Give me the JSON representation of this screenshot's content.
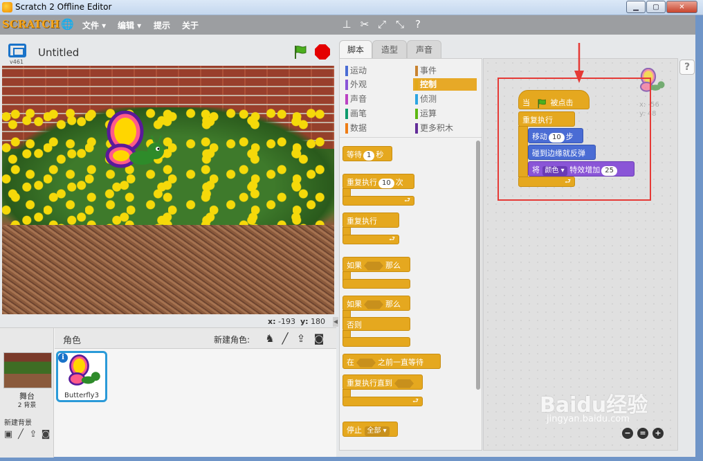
{
  "window": {
    "title": "Scratch 2 Offline Editor"
  },
  "menu": {
    "logo": "SCRATCH",
    "items": [
      "文件 ▾",
      "编辑 ▾",
      "提示",
      "关于"
    ]
  },
  "stage": {
    "version": "v461",
    "project_title": "Untitled",
    "mouse_x_label": "x:",
    "mouse_x": "-193",
    "mouse_y_label": "y:",
    "mouse_y": "180"
  },
  "sprites_pane": {
    "title": "角色",
    "new_sprite_label": "新建角色:",
    "stage_label": "舞台",
    "stage_bg_count": "2 背景",
    "new_backdrop_label": "新建背景",
    "sprite_name": "Butterfly3"
  },
  "tabs": [
    "脚本",
    "造型",
    "声音"
  ],
  "categories": [
    {
      "label": "运动",
      "color": "#4a6cd4"
    },
    {
      "label": "外观",
      "color": "#8a55d7"
    },
    {
      "label": "声音",
      "color": "#bb42c3"
    },
    {
      "label": "画笔",
      "color": "#0e9a6c"
    },
    {
      "label": "数据",
      "color": "#ee7d16"
    },
    {
      "label": "事件",
      "color": "#c88330"
    },
    {
      "label": "控制",
      "color": "#e1a91a"
    },
    {
      "label": "侦测",
      "color": "#2ca5e2"
    },
    {
      "label": "运算",
      "color": "#5cb712"
    },
    {
      "label": "更多积木",
      "color": "#632d99"
    }
  ],
  "palette_blocks": {
    "wait_pre": "等待",
    "wait_num": "1",
    "wait_post": "秒",
    "repeat_pre": "重复执行",
    "repeat_num": "10",
    "repeat_post": "次",
    "forever": "重复执行",
    "if_pre": "如果",
    "if_post": "那么",
    "ifelse_pre": "如果",
    "ifelse_post": "那么",
    "else": "否则",
    "waituntil_pre": "在",
    "waituntil_post": "之前一直等待",
    "repeatuntil": "重复执行直到",
    "stop_pre": "停止",
    "stop_dd": "全部"
  },
  "script": {
    "hat_pre": "当",
    "hat_post": "被点击",
    "forever": "重复执行",
    "move_pre": "移动",
    "move_num": "10",
    "move_post": "步",
    "bounce": "碰到边缘就反弹",
    "effect_pre": "将",
    "effect_dd": "颜色",
    "effect_mid": "特效增加",
    "effect_num": "25"
  },
  "sprite_info": {
    "x_label": "x:",
    "x": "-56",
    "y_label": "y:",
    "y": "48"
  },
  "watermark": {
    "brand": "Baidu经验",
    "url": "jingyan.baidu.com"
  }
}
